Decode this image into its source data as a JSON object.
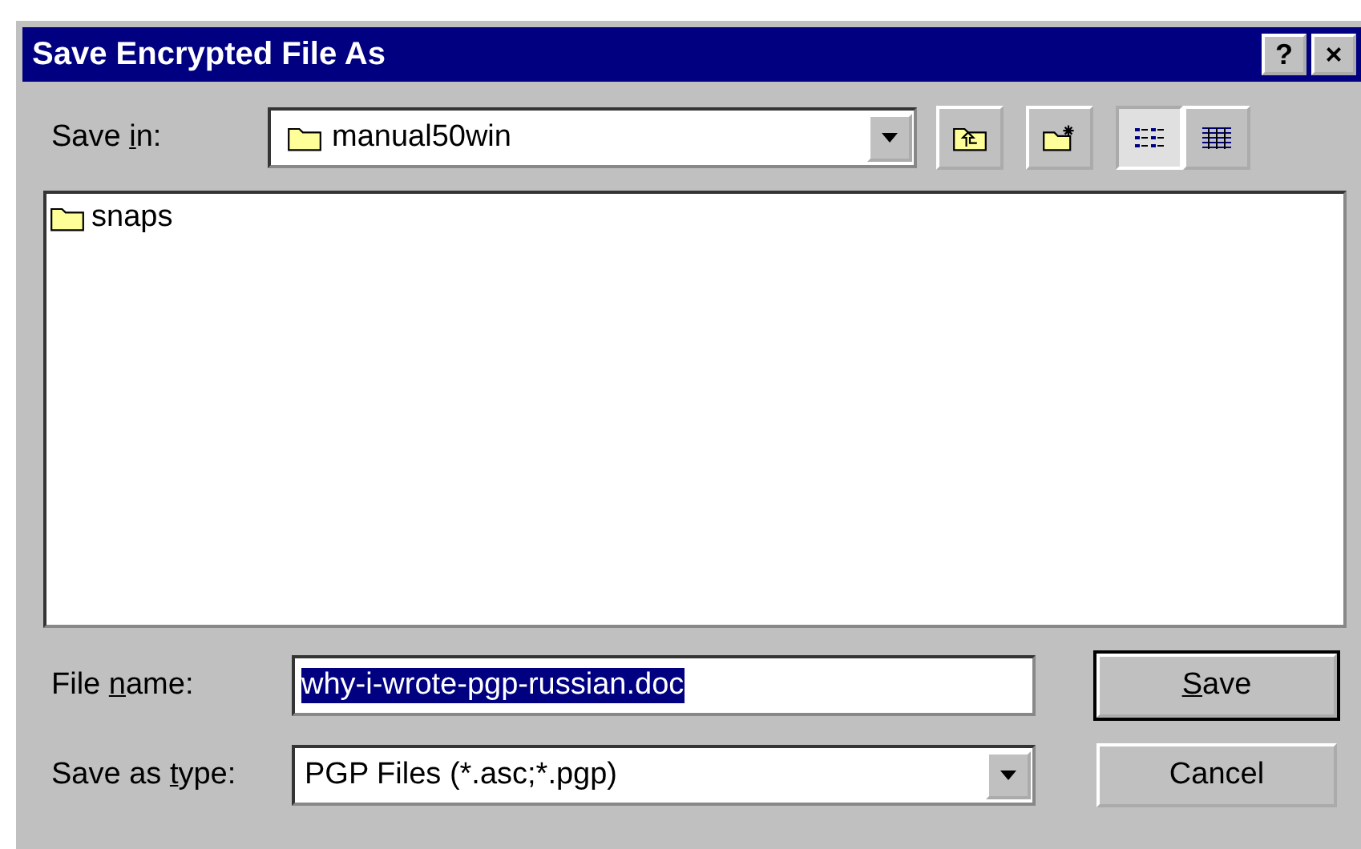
{
  "window": {
    "title": "Save Encrypted File As",
    "title_buttons": [
      "?",
      "×"
    ]
  },
  "save_in": {
    "label_parts": {
      "before": "Save ",
      "key": "i",
      "after": "n:"
    },
    "value": "manual50win"
  },
  "toolbar": [
    {
      "kind": "up"
    },
    {
      "kind": "new-folder"
    },
    {
      "kind": "list",
      "selected": true
    },
    {
      "kind": "details",
      "selected": false
    }
  ],
  "files": [
    {
      "name": "snaps"
    }
  ],
  "file_name": {
    "label_parts": {
      "before": "File ",
      "key": "n",
      "after": "ame:"
    },
    "value": "why-i-wrote-pgp-russian.doc"
  },
  "save_as_type": {
    "label_parts": {
      "before": "Save as ",
      "key": "t",
      "after": "ype:"
    },
    "value": "PGP Files (*.asc;*.pgp)"
  },
  "buttons": [
    {
      "label_parts": {
        "key": "S",
        "after": "ave"
      },
      "default": true
    },
    {
      "label_parts": {
        "before": "Cancel"
      },
      "default": false
    }
  ]
}
